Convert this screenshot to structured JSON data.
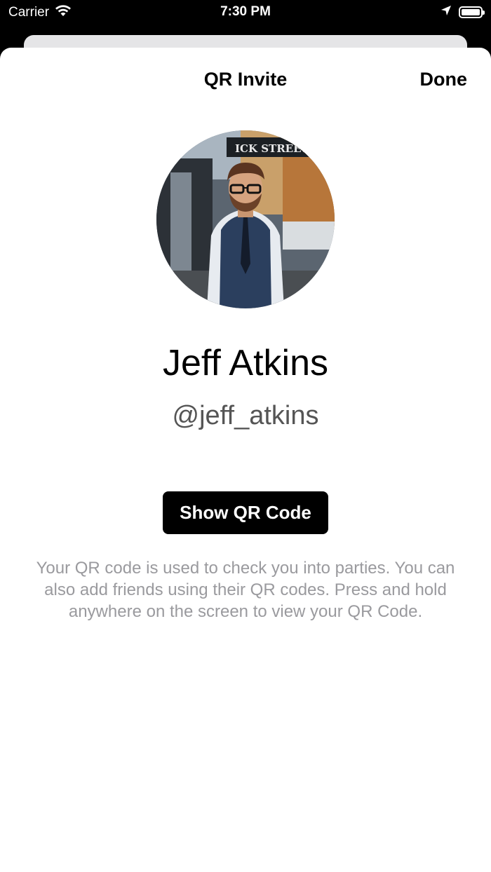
{
  "status_bar": {
    "carrier": "Carrier",
    "time": "7:30 PM",
    "icons": [
      "wifi-icon",
      "location-arrow-icon",
      "battery-icon"
    ]
  },
  "nav": {
    "title": "QR Invite",
    "done_label": "Done"
  },
  "profile": {
    "name": "Jeff Atkins",
    "handle": "@jeff_atkins",
    "avatar_sign_text": "ICK STREET"
  },
  "actions": {
    "show_qr_label": "Show QR Code"
  },
  "description": "Your QR code is used to check you into parties. You can also add friends using their QR codes. Press and hold anywhere on the screen to view your QR Code.",
  "colors": {
    "primary_button": "#000000",
    "sheet_background": "#ffffff",
    "description_text": "#9a9a9e",
    "handle_text": "#555555"
  }
}
